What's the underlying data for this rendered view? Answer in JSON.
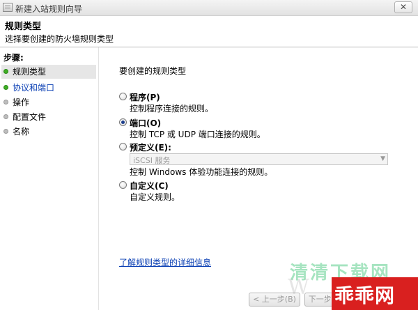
{
  "window": {
    "title": "新建入站规则向导",
    "close_glyph": "✕"
  },
  "header": {
    "title": "规则类型",
    "subtitle": "选择要创建的防火墙规则类型"
  },
  "sidebar": {
    "heading": "步骤:",
    "items": [
      {
        "label": "规则类型",
        "state": "current"
      },
      {
        "label": "协议和端口",
        "state": "link"
      },
      {
        "label": "操作",
        "state": "pending"
      },
      {
        "label": "配置文件",
        "state": "pending"
      },
      {
        "label": "名称",
        "state": "pending"
      }
    ]
  },
  "main": {
    "question": "要创建的规则类型",
    "options": [
      {
        "label": "程序(P)",
        "description": "控制程序连接的规则。",
        "selected": false
      },
      {
        "label": "端口(O)",
        "description": "控制 TCP 或 UDP 端口连接的规则。",
        "selected": true
      },
      {
        "label": "预定义(E):",
        "combo_value": "iSCSI 服务",
        "description": "控制 Windows 体验功能连接的规则。",
        "selected": false
      },
      {
        "label": "自定义(C)",
        "description": "自定义规则。",
        "selected": false
      }
    ],
    "learn_more": "了解规则类型的详细信息"
  },
  "buttons": {
    "back": "< 上一步(B)",
    "next": "下一步(N) >"
  },
  "watermark": {
    "top": "清清下载网",
    "bottom": "乖乖网"
  },
  "colors": {
    "link": "#0a3fb4",
    "step_done": "#3fae25",
    "step_pending": "#bdbdbd",
    "watermark_badge": "#d9201f"
  }
}
